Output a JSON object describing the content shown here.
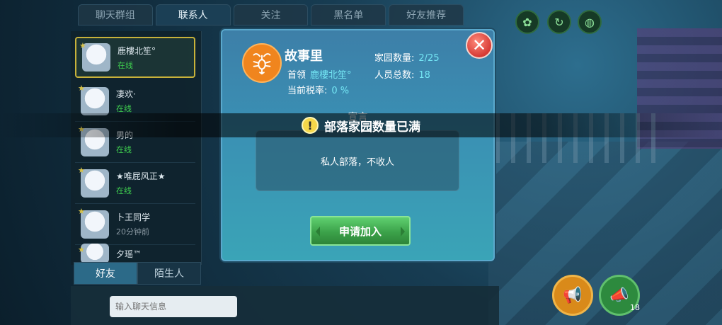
{
  "tabs": [
    "聊天群组",
    "联系人",
    "关注",
    "黑名单",
    "好友推荐"
  ],
  "active_tab_index": 1,
  "contacts": [
    {
      "name": "鹿樓北笙°",
      "status": "在线"
    },
    {
      "name": "凄欢·",
      "status": "在线"
    },
    {
      "name": "男的",
      "status": "在线"
    },
    {
      "name": "★唯屁风正★",
      "status": "在线"
    },
    {
      "name": "卜王同学",
      "status": "20分钟前"
    },
    {
      "name": "夕瑶™",
      "status": ""
    }
  ],
  "bottom_tabs": {
    "friends": "好友",
    "strangers": "陌生人"
  },
  "chat": {
    "placeholder": "输入聊天信息"
  },
  "dialog": {
    "tribe_name": "故事里",
    "leader_label": "首领",
    "leader_value": "鹿樓北笙°",
    "tax_label": "当前税率:",
    "tax_value": "0 %",
    "home_count_label": "家园数量:",
    "home_count_value": "2/25",
    "member_total_label": "人员总数:",
    "member_total_value": "18",
    "declaration_title": "宣言",
    "declaration_text": "私人部落，不收人",
    "apply_label": "申请加入",
    "emblem_icon": "scorpion-icon"
  },
  "toast": {
    "message": "部落家园数量已满",
    "icon": "warning-icon"
  },
  "hud": {
    "count": "18"
  },
  "colors": {
    "accent_value": "#74e6f4",
    "apply_green": "#3ca24a",
    "close_red": "#d63a35",
    "emblem_orange": "#f0851e"
  }
}
